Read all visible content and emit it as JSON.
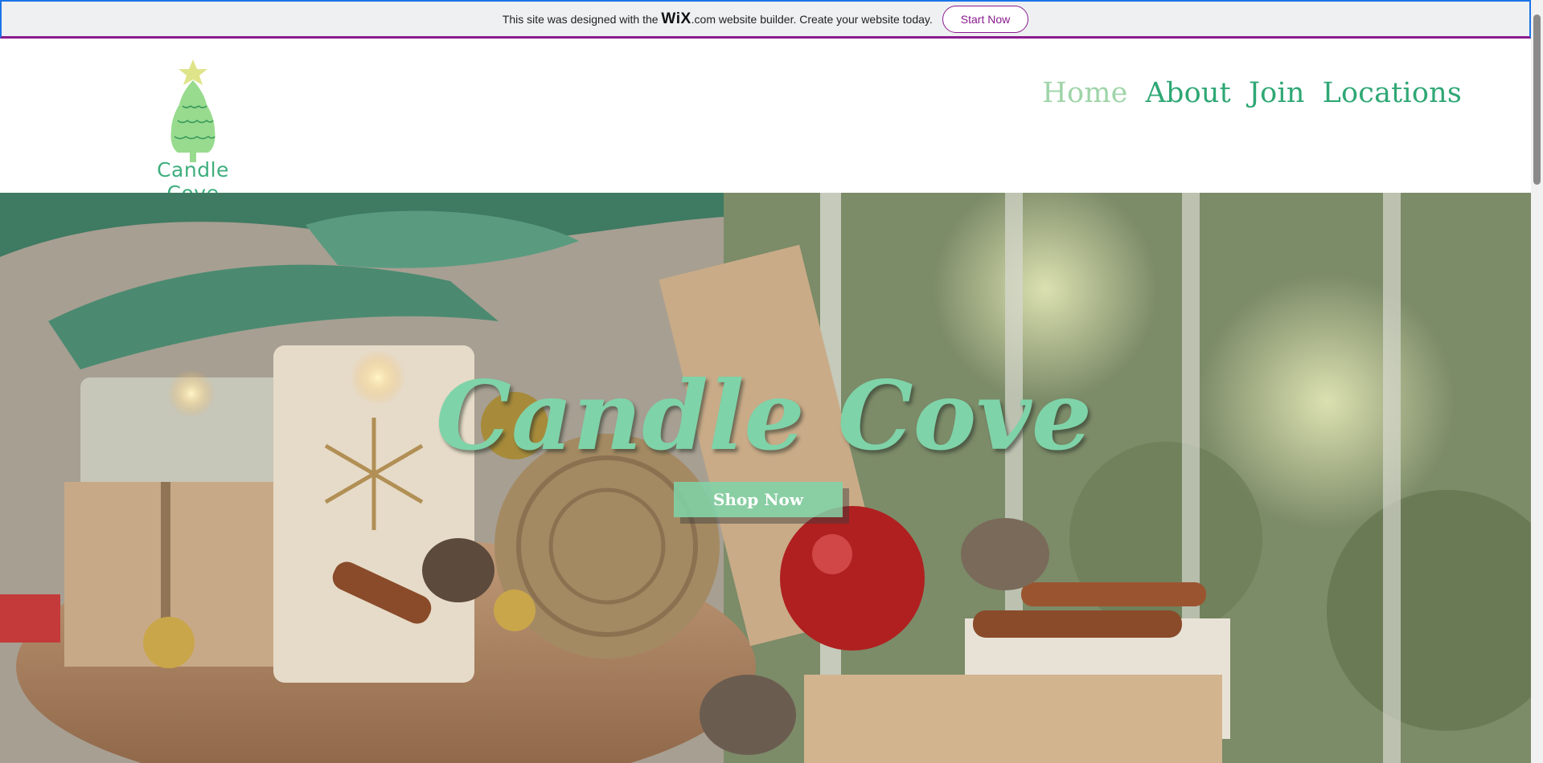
{
  "banner": {
    "text_before": "This site was designed with the",
    "wix_brand": "WiX",
    "text_after": ".com website builder. Create your website today.",
    "cta_label": "Start Now"
  },
  "header": {
    "logo_text": "Candle Cove",
    "logo_icon": "christmas-tree-icon",
    "nav": [
      {
        "label": "Home",
        "active": true
      },
      {
        "label": "About",
        "active": false
      },
      {
        "label": "Join",
        "active": false
      },
      {
        "label": "Locations",
        "active": false
      }
    ]
  },
  "hero": {
    "title": "Candle Cove",
    "cta_label": "Shop Now"
  },
  "colors": {
    "brand_green": "#2fa774",
    "active_nav": "#9fd4a8",
    "hero_title": "#7fd3a8",
    "wix_accent": "#8a1c8e"
  }
}
